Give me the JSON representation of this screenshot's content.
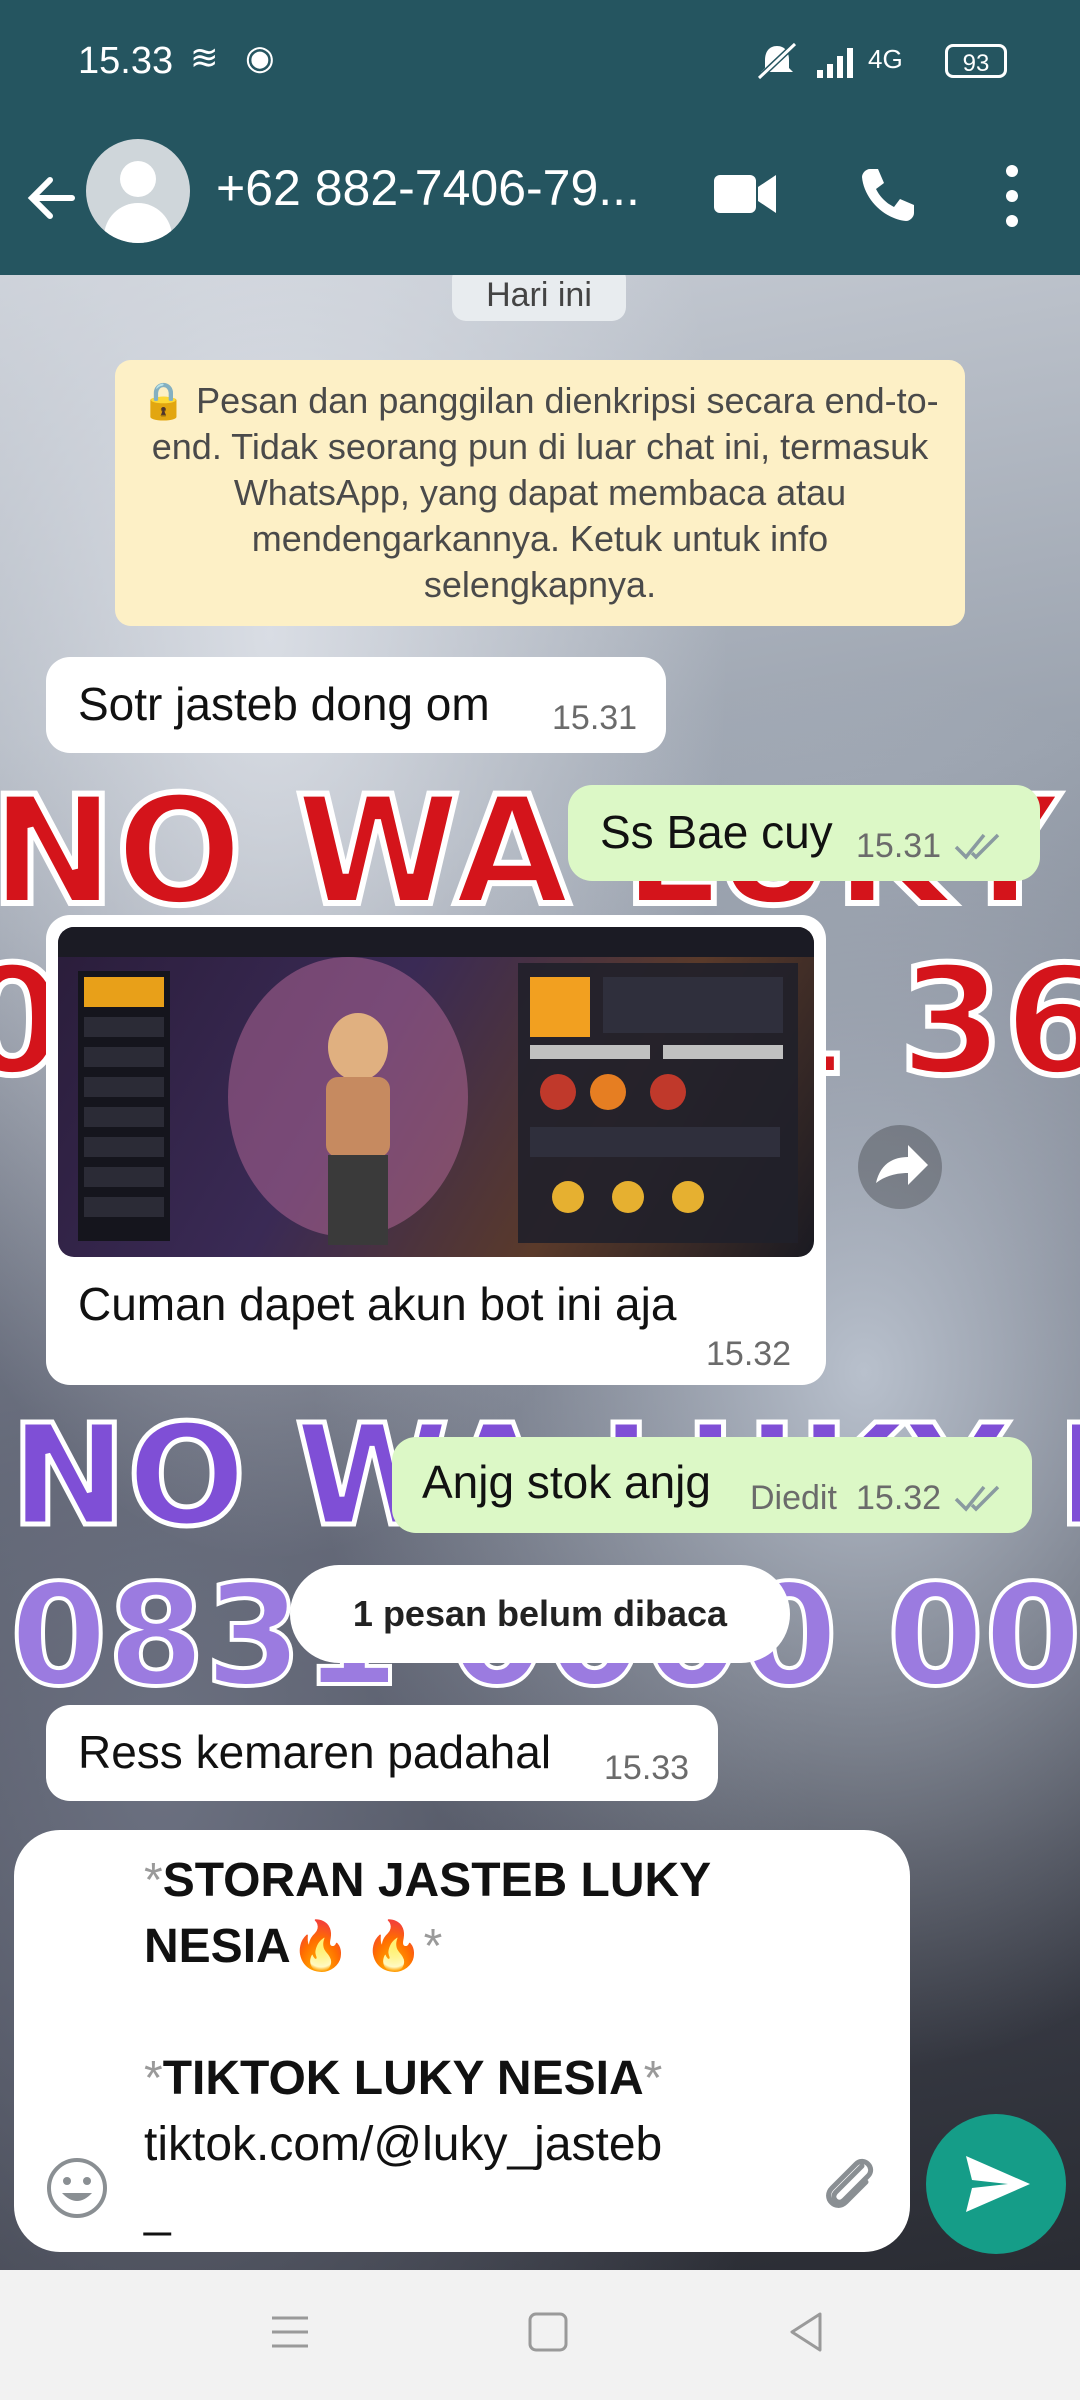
{
  "status_bar": {
    "time": "15.33",
    "network": "4G",
    "battery": "93"
  },
  "header": {
    "contact": "+62 882-7406-79..."
  },
  "chat": {
    "date_label": "Hari ini",
    "encryption_notice": "🔒 Pesan dan panggilan dienkripsi secara end-to-end. Tidak seorang pun di luar chat ini, termasuk WhatsApp, yang dapat membaca atau mendengarkannya. Ketuk untuk info selengkapnya.",
    "messages": [
      {
        "direction": "in",
        "text": "Sotr jasteb dong om",
        "time": "15.31"
      },
      {
        "direction": "out",
        "text": "Ss Bae cuy",
        "time": "15.31",
        "status": "read"
      },
      {
        "direction": "in",
        "type": "image",
        "caption": "Cuman dapet akun bot ini aja",
        "time": "15.32"
      },
      {
        "direction": "out",
        "text": "Anjg stok anjg",
        "edited_label": "Diedit",
        "time": "15.32",
        "status": "read"
      },
      {
        "direction": "in",
        "text": "Ress kemaren padahal",
        "time": "15.33"
      }
    ],
    "unread_label": "1 pesan belum dibaca"
  },
  "compose": {
    "line1_bold": "STORAN JASTEB LUKY",
    "line2_bold": "NESIA🔥 🔥",
    "line3_bold": "TIKTOK LUKY NESIA",
    "line4": "tiktok.com/@luky_jasteb",
    "line5": "_",
    "asterisk": "*"
  },
  "colors": {
    "header_bg": "#255560",
    "outgoing_bubble": "#dcf8c6",
    "send_button": "#159d88"
  }
}
